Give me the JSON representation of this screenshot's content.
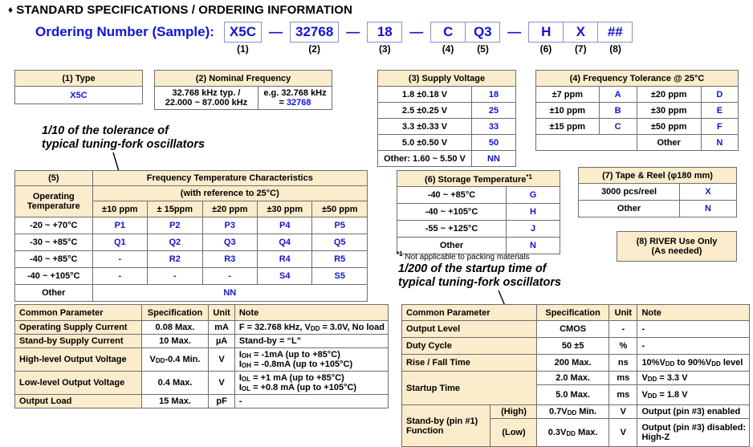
{
  "title": "STANDARD SPECIFICATIONS / ORDERING INFORMATION",
  "diamond": "♦",
  "ordering": {
    "label": "Ordering Number (Sample):",
    "dash": "—",
    "segments": [
      {
        "values": [
          "X5C"
        ],
        "captions": [
          "(1)"
        ]
      },
      {
        "values": [
          "32768"
        ],
        "captions": [
          "(2)"
        ]
      },
      {
        "values": [
          "18"
        ],
        "captions": [
          "(3)"
        ]
      },
      {
        "values": [
          "C",
          "Q3"
        ],
        "captions": [
          "(4)",
          "(5)"
        ]
      },
      {
        "values": [
          "H",
          "X",
          "##"
        ],
        "captions": [
          "(6)",
          "(7)",
          "(8)"
        ]
      }
    ]
  },
  "colors": {
    "header_fill": "#fbeccc",
    "code_blue": "#1313d6",
    "border": "#6e6e6e"
  },
  "type_table": {
    "header": "(1)  Type",
    "value": "X5C"
  },
  "nominal_frequency": {
    "header": "(2)  Nominal Frequency",
    "left_line1": "32.768 kHz typ. /",
    "left_line2": "22.000 ~ 87.000 kHz",
    "right_line1": "e.g. 32.768 kHz",
    "right_prefix": "= ",
    "right_code": "32768"
  },
  "supply_voltage": {
    "header": "(3)  Supply Voltage",
    "rows": [
      {
        "spec": "1.8 ±0.18 V",
        "code": "18"
      },
      {
        "spec": "2.5 ±0.25 V",
        "code": "25"
      },
      {
        "spec": "3.3 ±0.33 V",
        "code": "33"
      },
      {
        "spec": "5.0 ±0.50 V",
        "code": "50"
      },
      {
        "spec": "Other: 1.60 ~ 5.50 V",
        "code": "NN"
      }
    ]
  },
  "frequency_tolerance": {
    "header": "(4)  Frequency Tolerance @ 25°C",
    "rows": [
      {
        "spec_a": "±7 ppm",
        "code_a": "A",
        "spec_b": "±20 ppm",
        "code_b": "D"
      },
      {
        "spec_a": "±10 ppm",
        "code_a": "B",
        "spec_b": "±30 ppm",
        "code_b": "E"
      },
      {
        "spec_a": "±15 ppm",
        "code_a": "C",
        "spec_b": "±50 ppm",
        "code_b": "F"
      },
      {
        "spec_a": "",
        "code_a": "",
        "spec_b": "Other",
        "code_b": "N"
      }
    ]
  },
  "annotation_tolerance": {
    "line1": "1/10 of the tolerance of",
    "line2": "typical tuning-fork oscillators"
  },
  "annotation_startup": {
    "line1": "1/200 of the startup time of",
    "line2": "typical tuning-fork oscillators"
  },
  "freq_temp": {
    "corner_number": "(5)",
    "corner_label_line1": "Operating",
    "corner_label_line2": "Temperature",
    "header_line1": "Frequency Temperature Characteristics",
    "header_line2": "(with reference to 25°C)",
    "columns": [
      "±10 ppm",
      "± 15ppm",
      "±20 ppm",
      "±30 ppm",
      "±50 ppm"
    ],
    "rows": [
      {
        "temp": "-20 ~ +70°C",
        "codes": [
          "P1",
          "P2",
          "P3",
          "P4",
          "P5"
        ]
      },
      {
        "temp": "-30 ~ +85°C",
        "codes": [
          "Q1",
          "Q2",
          "Q3",
          "Q4",
          "Q5"
        ]
      },
      {
        "temp": "-40 ~ +85°C",
        "codes": [
          "-",
          "R2",
          "R3",
          "R4",
          "R5"
        ]
      },
      {
        "temp": "-40 ~ +105°C",
        "codes": [
          "-",
          "-",
          "-",
          "S4",
          "S5"
        ]
      }
    ],
    "other_label": "Other",
    "other_code": "NN"
  },
  "storage_temperature": {
    "header": "(6)  Storage Temperature",
    "header_sup": "*1",
    "rows": [
      {
        "spec": "-40 ~ +85°C",
        "code": "G"
      },
      {
        "spec": "-40 ~ +105°C",
        "code": "H"
      },
      {
        "spec": "-55 ~ +125°C",
        "code": "J"
      },
      {
        "spec": "Other",
        "code": "N"
      }
    ],
    "footnote_sup": "*1",
    "footnote": " Not applicable to packing materials"
  },
  "tape_reel": {
    "header": "(7)  Tape & Reel (φ180 mm)",
    "rows": [
      {
        "spec": "3000 pcs/reel",
        "code": "X"
      },
      {
        "spec": "Other",
        "code": "N"
      }
    ]
  },
  "river_use": {
    "line1": "(8)  RIVER Use Only",
    "line2": "(As needed)"
  },
  "param_left": {
    "headers": [
      "Common Parameter",
      "Specification",
      "Unit",
      "Note"
    ],
    "rows": [
      {
        "parameter": "Operating Supply Current",
        "spec": "0.08 Max.",
        "unit": "mA",
        "note": "F = 32.768 kHz, V<sub class=\"s\">DD</sub> = 3.0V, No load"
      },
      {
        "parameter": "Stand-by Supply Current",
        "spec": "10 Max.",
        "unit": "µA",
        "note": "Stand-by = “L”"
      },
      {
        "parameter": "High-level Output Voltage",
        "spec": "V<sub class=\"s\">DD</sub>-0.4 Min.",
        "unit": "V",
        "note": "I<sub class=\"s\">OH</sub> = -1mA (up to +85°C)<br>I<sub class=\"s\">OH</sub> = -0.8mA (up to +105°C)"
      },
      {
        "parameter": "Low-level Output Voltage",
        "spec": "0.4 Max.",
        "unit": "V",
        "note": "I<sub class=\"s\">OL</sub> = +1 mA (up to +85°C)<br>I<sub class=\"s\">OL</sub> = +0.8 mA (up to +105°C)"
      },
      {
        "parameter": "Output Load",
        "spec": "15 Max.",
        "unit": "pF",
        "note": "-"
      }
    ]
  },
  "param_right": {
    "headers": [
      "Common Parameter",
      "Specification",
      "Unit",
      "Note"
    ],
    "rows": [
      {
        "parameter": "Output Level",
        "sub": "",
        "spec": "CMOS",
        "unit": "-",
        "note": "-"
      },
      {
        "parameter": "Duty Cycle",
        "sub": "",
        "spec": "50 ±5",
        "unit": "%",
        "note": "-"
      },
      {
        "parameter": "Rise / Fall Time",
        "sub": "",
        "spec": "200 Max.",
        "unit": "ns",
        "note": "10%V<sub class=\"s\">DD</sub> to 90%V<sub class=\"s\">DD</sub> level"
      },
      {
        "parameter": "Startup Time",
        "sub": "",
        "spec": "2.0 Max.",
        "unit": "ms",
        "note": "V<sub class=\"s\">DD</sub> = 3.3 V"
      },
      {
        "parameter": "",
        "sub": "",
        "spec": "5.0 Max.",
        "unit": "ms",
        "note": "V<sub class=\"s\">DD</sub> = 1.8 V"
      },
      {
        "parameter": "Stand-by (pin #1) Function",
        "sub": "(High)",
        "spec": "0.7V<sub class=\"s\">DD</sub> Min.",
        "unit": "V",
        "note": "Output (pin #3) enabled"
      },
      {
        "parameter": "",
        "sub": "(Low)",
        "spec": "0.3V<sub class=\"s\">DD</sub> Max.",
        "unit": "V",
        "note": "Output (pin #3) disabled:<br>High-Z"
      }
    ],
    "startup_label": "Startup Time",
    "standby_label_line1": "Stand-by (pin #1)",
    "standby_label_line2": "Function"
  }
}
